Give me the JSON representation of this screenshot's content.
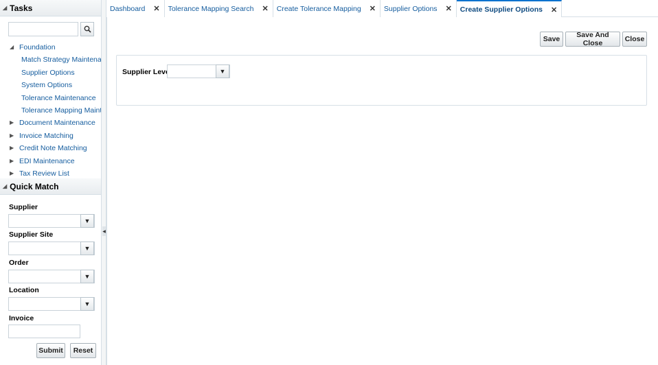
{
  "tasks": {
    "title": "Tasks",
    "search_value": "",
    "tree": [
      {
        "label": "Foundation",
        "expanded": true,
        "children": [
          "Match Strategy Maintenance",
          "Supplier Options",
          "System Options",
          "Tolerance Maintenance",
          "Tolerance Mapping Maintena"
        ]
      },
      {
        "label": "Document Maintenance",
        "expanded": false
      },
      {
        "label": "Invoice Matching",
        "expanded": false
      },
      {
        "label": "Credit Note Matching",
        "expanded": false
      },
      {
        "label": "EDI Maintenance",
        "expanded": false
      },
      {
        "label": "Tax Review List",
        "expanded": false
      }
    ]
  },
  "quick_match": {
    "title": "Quick Match",
    "fields": {
      "supplier_label": "Supplier",
      "supplier_site_label": "Supplier Site",
      "order_label": "Order",
      "location_label": "Location",
      "invoice_label": "Invoice"
    },
    "submit_label": "Submit",
    "reset_label": "Reset"
  },
  "tabs": [
    {
      "label": "Dashboard",
      "active": false
    },
    {
      "label": "Tolerance Mapping Search",
      "active": false
    },
    {
      "label": "Create Tolerance Mapping",
      "active": false
    },
    {
      "label": "Supplier Options",
      "active": false
    },
    {
      "label": "Create Supplier Options",
      "active": true
    }
  ],
  "toolbar": {
    "save_label": "Save",
    "save_close_label": "Save And Close",
    "close_label": "Close"
  },
  "form": {
    "supplier_level_label": "Supplier Level",
    "supplier_level_value": ""
  },
  "colors": {
    "link": "#145c9e",
    "active_tab_border": "#0572ce",
    "border": "#d6dfe6"
  },
  "icons": {
    "search": "magnifier-icon",
    "dropdown": "caret-down-icon",
    "close": "close-x-icon"
  }
}
